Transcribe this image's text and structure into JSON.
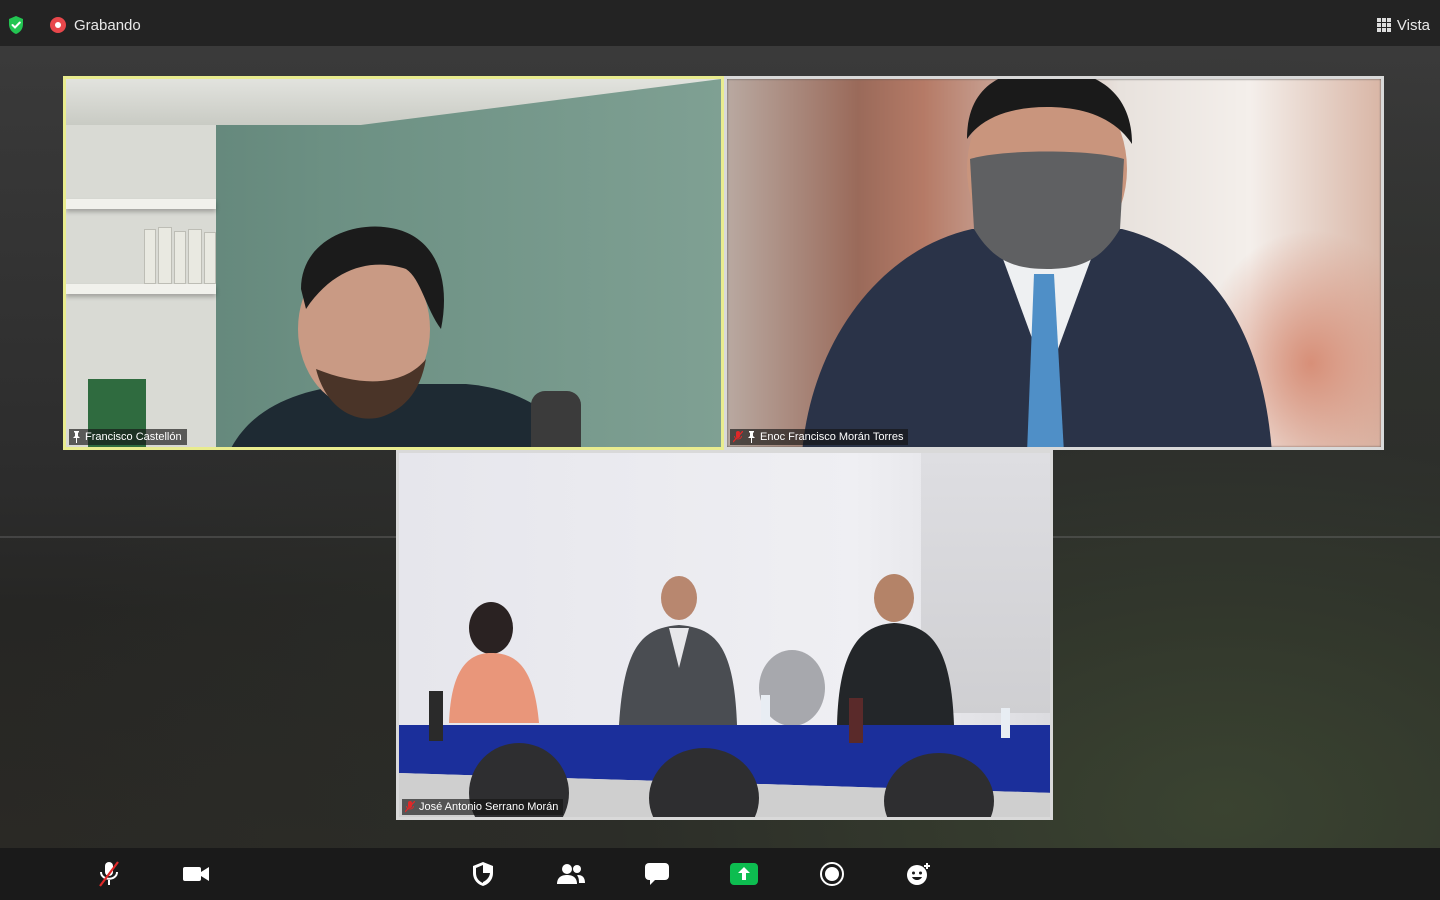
{
  "top_bar": {
    "recording_label": "Grabando",
    "view_label": "Vista"
  },
  "participants": [
    {
      "name": "Francisco Castellón",
      "active_speaker": true,
      "muted": false,
      "pinned": true
    },
    {
      "name": "Enoc Francisco Morán Torres",
      "active_speaker": false,
      "muted": true,
      "pinned": true
    },
    {
      "name": "José Antonio Serrano Morán",
      "active_speaker": false,
      "muted": true,
      "pinned": false
    }
  ],
  "toolbar": {
    "buttons": [
      {
        "icon": "mic-off-icon",
        "action": "unmute"
      },
      {
        "icon": "video-camera-icon",
        "action": "video"
      },
      {
        "icon": "security-shield-icon",
        "action": "security"
      },
      {
        "icon": "participants-icon",
        "action": "participants"
      },
      {
        "icon": "chat-icon",
        "action": "chat"
      },
      {
        "icon": "share-screen-icon",
        "action": "share"
      },
      {
        "icon": "record-icon",
        "action": "record"
      },
      {
        "icon": "reactions-icon",
        "action": "reactions"
      }
    ]
  },
  "colors": {
    "recording_red": "#e8474b",
    "secure_green": "#23c552",
    "share_green": "#0dbd50",
    "active_speaker_border": "#e9ec8f",
    "muted_red": "#e02828"
  }
}
